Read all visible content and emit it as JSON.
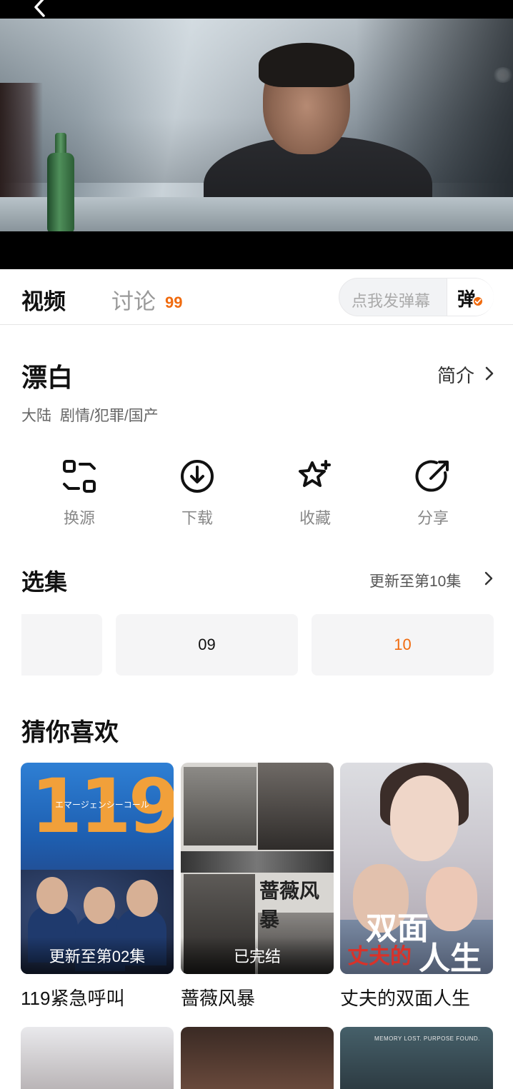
{
  "player": {
    "back_icon": "chevron-left-icon"
  },
  "tabs": {
    "video": "视频",
    "discuss": "讨论",
    "discuss_count": "99",
    "danmaku_placeholder": "点我发弹幕",
    "danmaku_button": "弹"
  },
  "show": {
    "title": "漂白",
    "intro_label": "简介",
    "meta_region": "大陆",
    "meta_genres": "剧情/犯罪/国产"
  },
  "actions": [
    {
      "label": "换源",
      "icon": "switch-source-icon"
    },
    {
      "label": "下载",
      "icon": "download-icon"
    },
    {
      "label": "收藏",
      "icon": "favorite-star-icon"
    },
    {
      "label": "分享",
      "icon": "share-icon"
    }
  ],
  "episodes": {
    "title": "选集",
    "update_label": "更新至第10集",
    "items": [
      "09",
      "10"
    ],
    "active": "10"
  },
  "recommend": {
    "title": "猜你喜欢",
    "items": [
      {
        "name": "119紧急呼叫",
        "badge": "更新至第02集",
        "poster_text": "119",
        "poster_sub": "エマージェンシーコール"
      },
      {
        "name": "蔷薇风暴",
        "badge": "已完结",
        "poster_text": "蔷薇风暴"
      },
      {
        "name": "丈夫的双面人生",
        "badge": "",
        "poster_text_1": "双面",
        "poster_text_2": "丈夫的",
        "poster_text_3": "人生"
      }
    ],
    "row2_tag": "MEMORY LOST. PURPOSE FOUND."
  },
  "colors": {
    "accent": "#f06b0f",
    "text_primary": "#111111",
    "text_secondary": "#888888",
    "card_bg": "#f5f5f6"
  }
}
